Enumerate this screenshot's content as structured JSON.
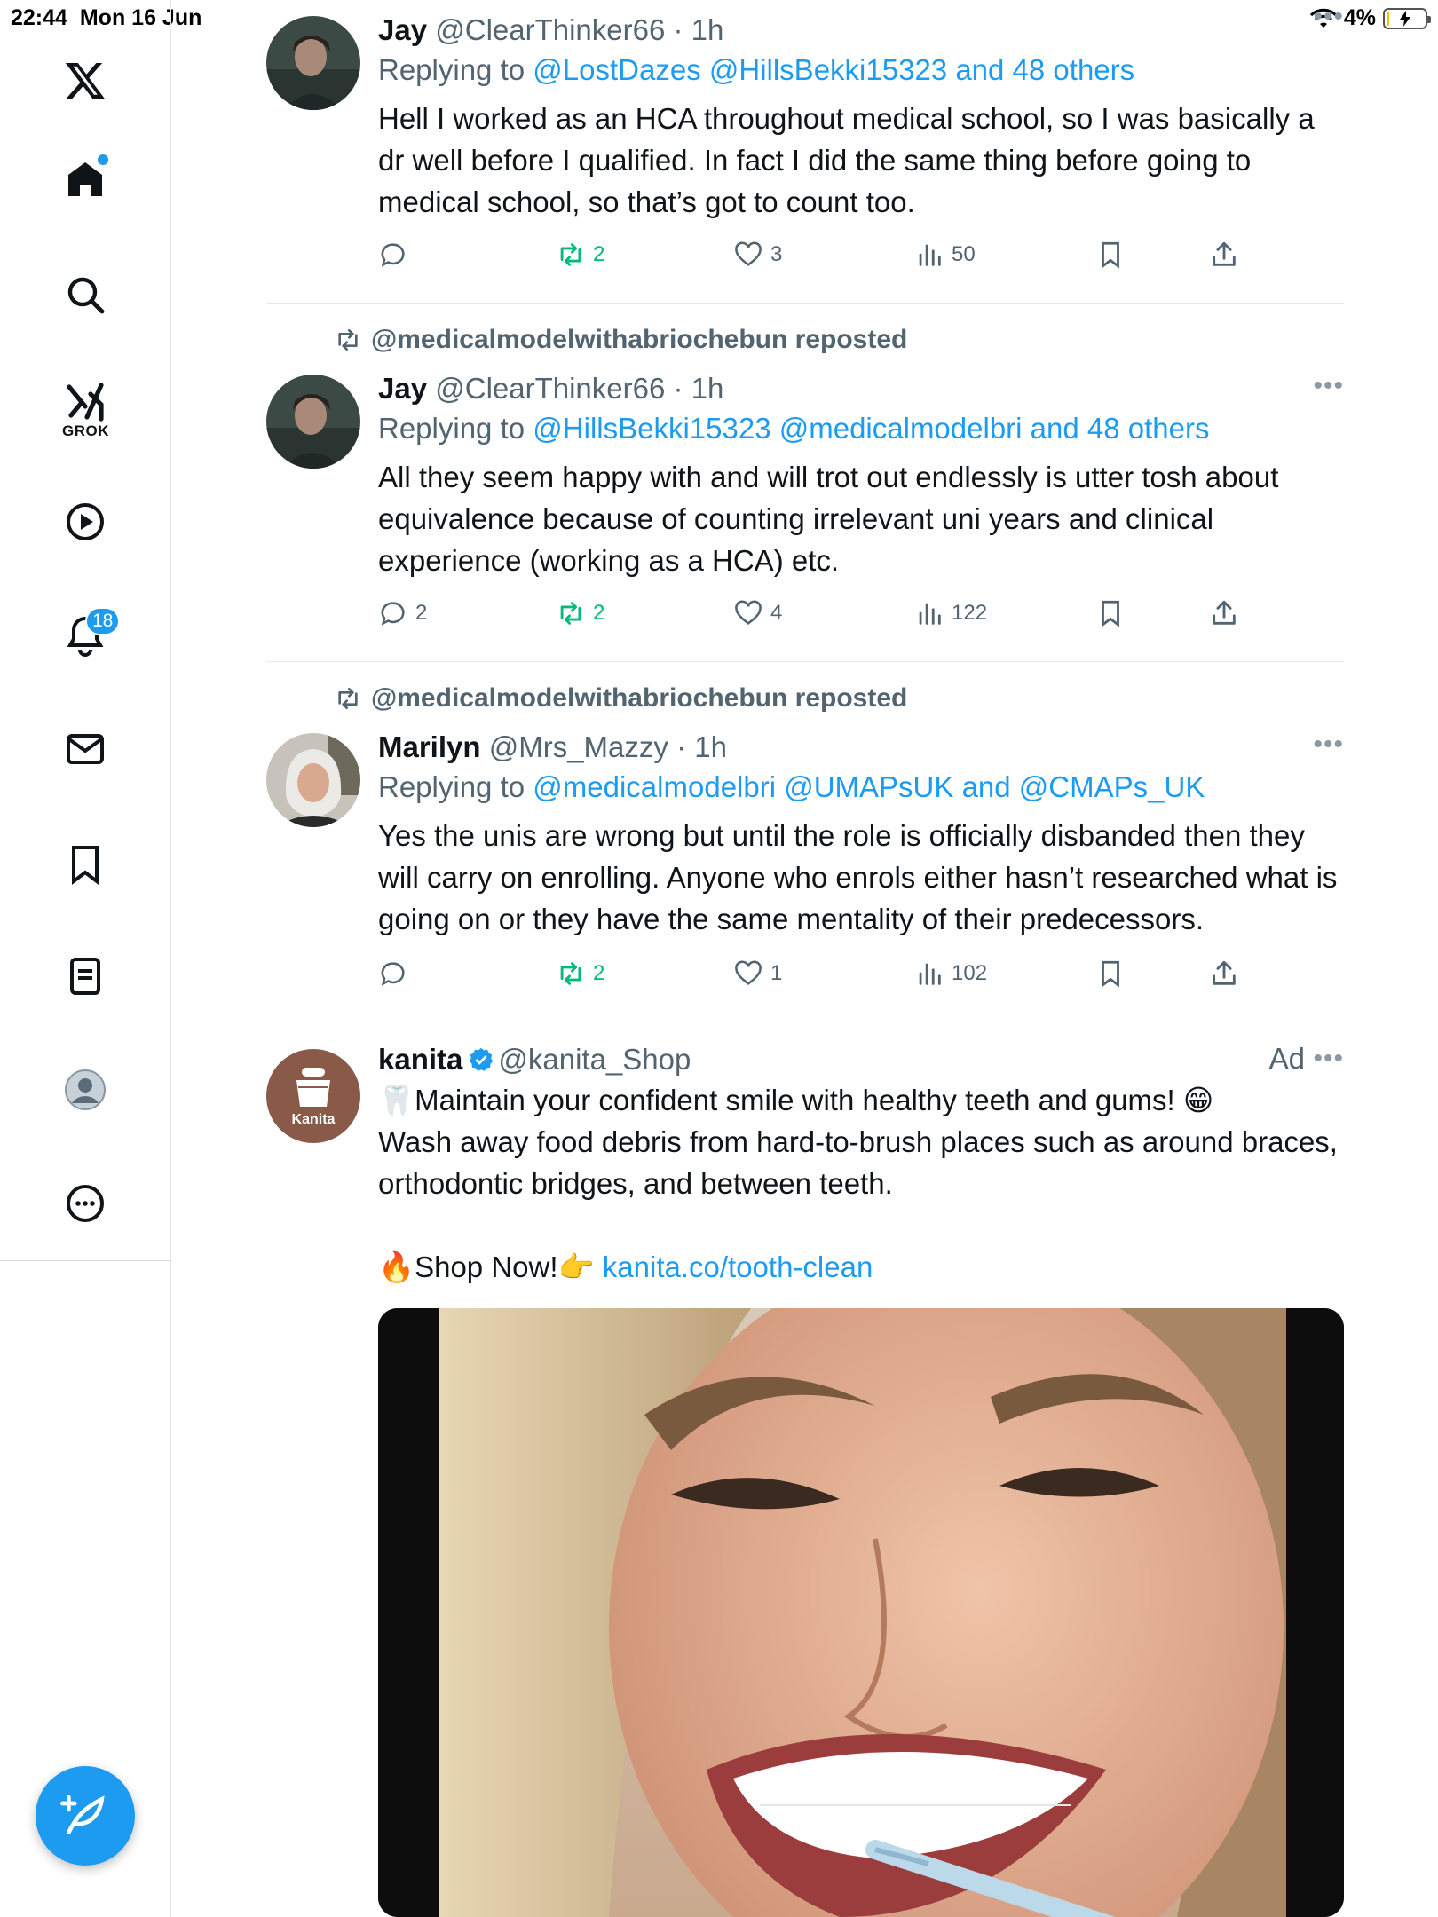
{
  "status_bar": {
    "time": "22:44",
    "date": "Mon 16 Jun",
    "battery": "4%"
  },
  "sidebar": {
    "items": [
      {
        "name": "x-logo"
      },
      {
        "name": "home"
      },
      {
        "name": "search"
      },
      {
        "name": "grok",
        "label": "GROK"
      },
      {
        "name": "video"
      },
      {
        "name": "notifications",
        "badge": "18"
      },
      {
        "name": "messages"
      },
      {
        "name": "bookmarks"
      },
      {
        "name": "lists"
      },
      {
        "name": "profile"
      },
      {
        "name": "more"
      }
    ]
  },
  "tweets": [
    {
      "name": "Jay",
      "handle": "@ClearThinker66",
      "time": "· 1h",
      "replying_prefix": "Replying to",
      "replying_links": "@LostDazes @HillsBekki15323 and 48 others",
      "text": "Hell I worked as an HCA throughout medical school, so I was basically a dr well before I qualified. In fact I did the same thing before going to medical school, so that’s got to count too.",
      "replies": "",
      "reposts": "2",
      "likes": "3",
      "views": "50"
    },
    {
      "reposted_by": "@medicalmodelwithabriochebun reposted",
      "name": "Jay",
      "handle": "@ClearThinker66",
      "time": "· 1h",
      "replying_prefix": "Replying to",
      "replying_links": "@HillsBekki15323 @medicalmodelbri and 48 others",
      "text": "All they seem happy with and will trot out endlessly is utter tosh about equivalence because of counting irrelevant uni years and clinical experience (working as a HCA) etc.",
      "replies": "2",
      "reposts": "2",
      "likes": "4",
      "views": "122"
    },
    {
      "reposted_by": "@medicalmodelwithabriochebun reposted",
      "name": "Marilyn",
      "handle": "@Mrs_Mazzy",
      "time": "· 1h",
      "replying_prefix": "Replying to",
      "replying_links": "@medicalmodelbri @UMAPsUK and @CMAPs_UK",
      "text": "Yes the unis are wrong but until the role is officially disbanded then they will carry on enrolling. Anyone who enrols either hasn’t researched what is going on or they have the same mentality of their predecessors.",
      "replies": "",
      "reposts": "2",
      "likes": "1",
      "views": "102"
    }
  ],
  "ad": {
    "name": "kanita",
    "handle": "@kanita_Shop",
    "ad_label": "Ad",
    "avatar_text": "Kanita",
    "line1": "🦷Maintain your confident smile with healthy teeth and gums! 😁",
    "line2": "Wash away food debris from hard-to-brush places such as around braces, orthodontic bridges, and between teeth.",
    "cta_prefix": "🔥Shop Now!👉 ",
    "cta_link": "kanita.co/tooth-clean"
  },
  "colors": {
    "accent": "#1d9bf0",
    "repost_green": "#00ba7c",
    "muted": "#536471"
  }
}
